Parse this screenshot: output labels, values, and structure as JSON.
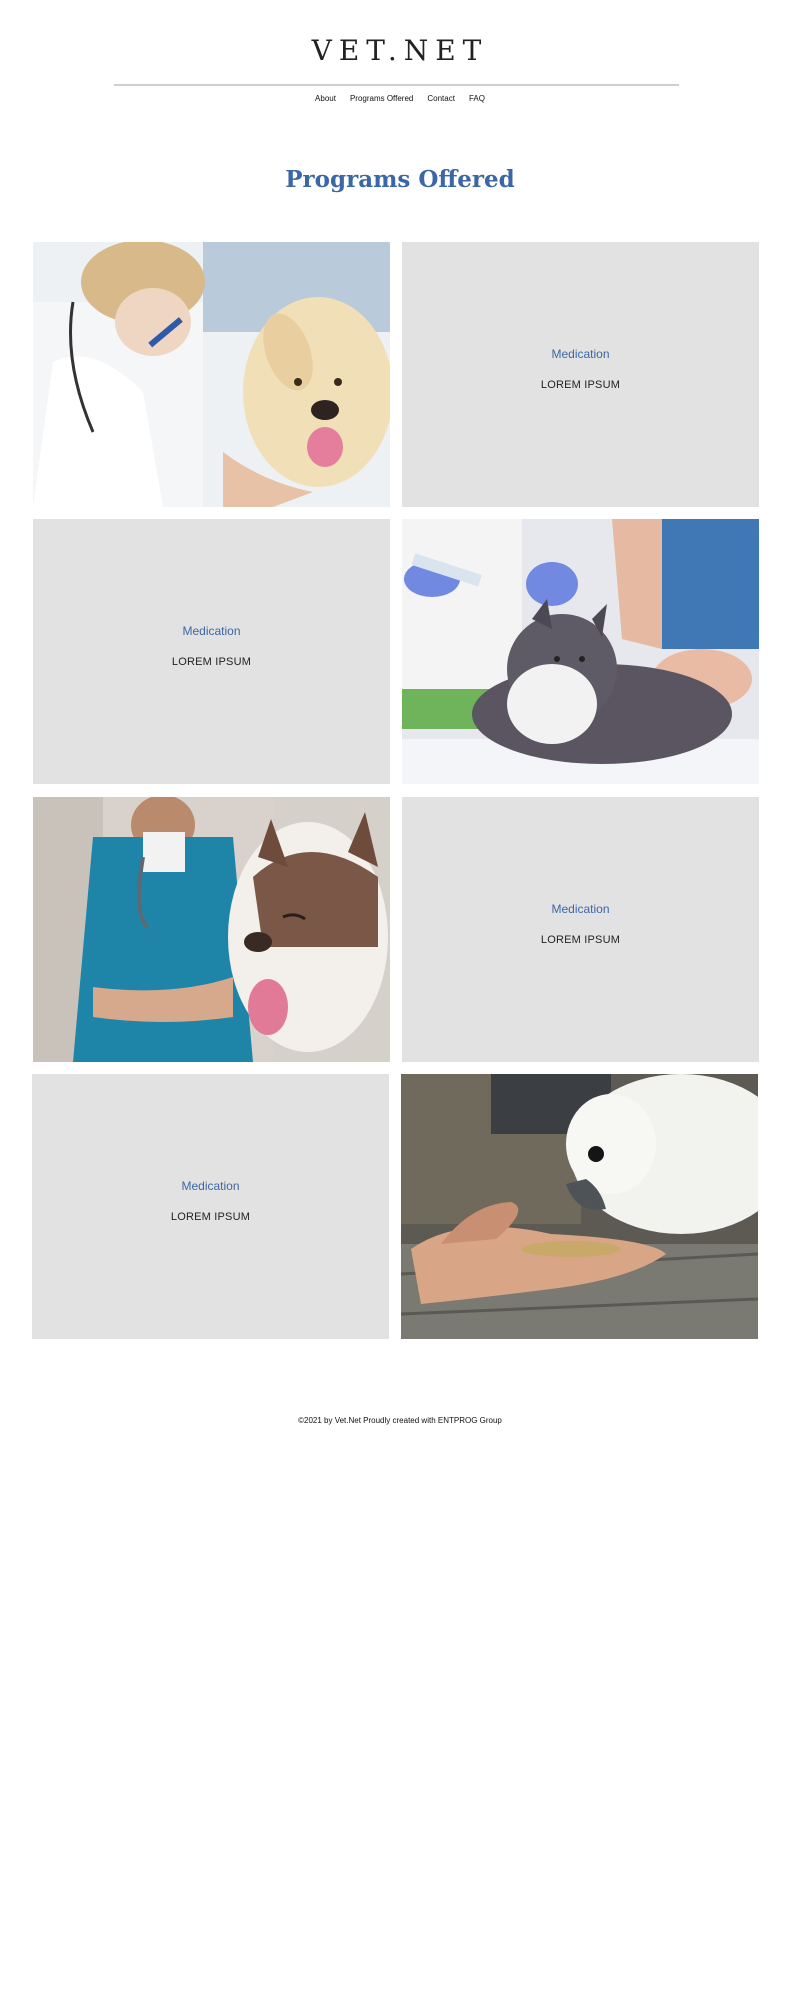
{
  "header": {
    "site_title": "VET.NET",
    "nav": [
      "About",
      "Programs Offered",
      "Contact",
      "FAQ"
    ]
  },
  "main": {
    "page_title": "Programs Offered",
    "tiles": [
      {
        "type": "image",
        "icon": "vet-examining-dog-ear-photo"
      },
      {
        "type": "text",
        "heading": "Medication",
        "body": "LOREM IPSUM"
      },
      {
        "type": "text",
        "heading": "Medication",
        "body": "LOREM IPSUM"
      },
      {
        "type": "image",
        "icon": "vet-injecting-cat-photo"
      },
      {
        "type": "image",
        "icon": "vet-with-husky-photo"
      },
      {
        "type": "text",
        "heading": "Medication",
        "body": "LOREM IPSUM"
      },
      {
        "type": "text",
        "heading": "Medication",
        "body": "LOREM IPSUM"
      },
      {
        "type": "image",
        "icon": "hand-feeding-cockatoo-photo"
      }
    ]
  },
  "footer": {
    "text": "©2021 by Vet.Net Proudly created with ENTPROG Group"
  },
  "colors": {
    "accent": "#3c67a6",
    "tile_bg": "#e2e2e2",
    "rule": "#cfcfcf"
  }
}
